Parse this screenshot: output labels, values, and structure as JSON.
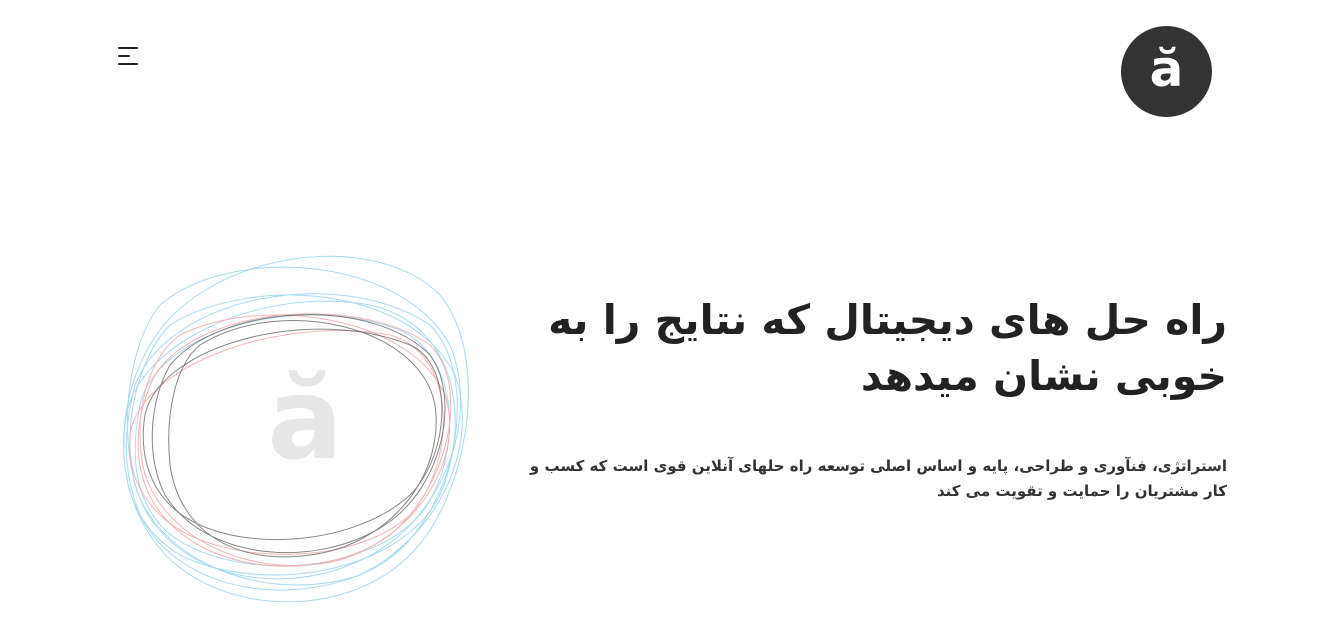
{
  "header": {
    "menu_icon": "hamburger-menu-icon",
    "logo_text": "ă"
  },
  "illustration": {
    "watermark_text": "ă",
    "colors": [
      "#9fd6f0",
      "#f2a8a8",
      "#555555"
    ]
  },
  "hero": {
    "title": "راه حل های دیجیتال که نتایج را به خوبی نشان میدهد",
    "description": "استراتژی، فنآوری و طراحی، پایه و اساس اصلی توسعه راه حلهای آنلاین قوی است که کسب و کار مشتریان را حمایت و تقویت می کند"
  }
}
